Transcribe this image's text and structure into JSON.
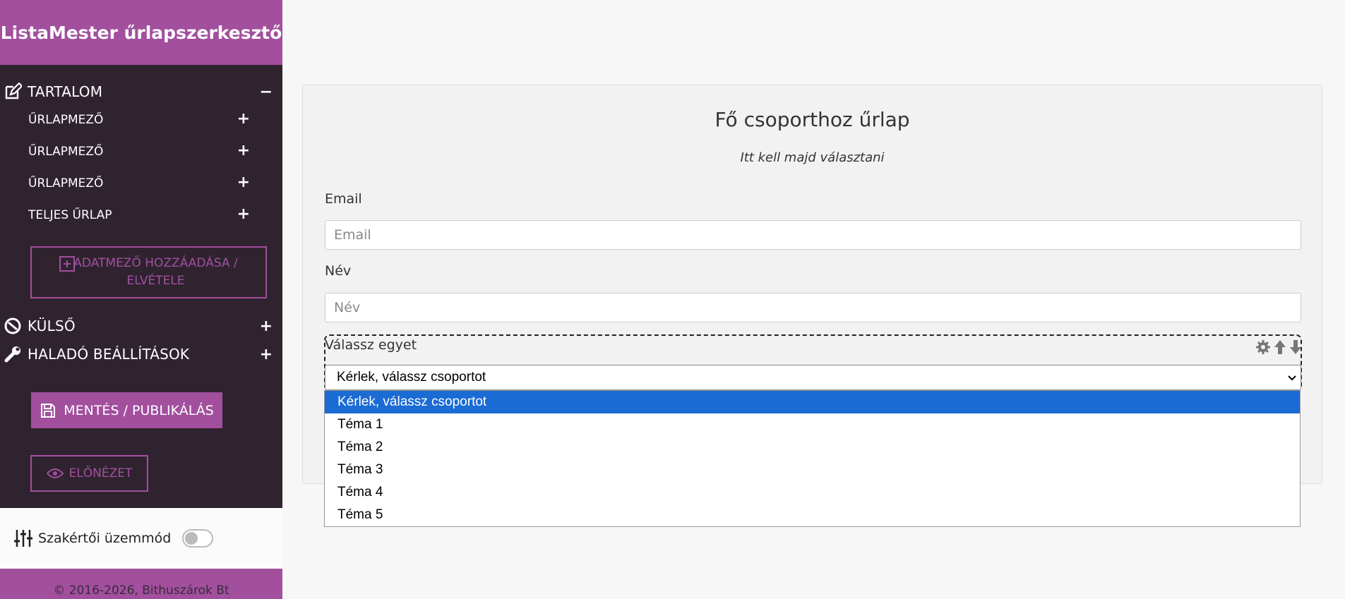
{
  "app": {
    "brand": "ListaMester űrlapszerkesztő"
  },
  "sidebar": {
    "content_section": {
      "label": "TARTALOM",
      "toggle": "−"
    },
    "items": [
      {
        "label": "ŰRLAPMEZŐ",
        "toggle": "+"
      },
      {
        "label": "ŰRLAPMEZŐ",
        "toggle": "+"
      },
      {
        "label": "ŰRLAPMEZŐ",
        "toggle": "+"
      },
      {
        "label": "TELJES ŰRLAP",
        "toggle": "+"
      }
    ],
    "add_field_button": "ADATMEZŐ HOZZÁADÁSA / ELVÉTELE",
    "external_section": {
      "label": "KÜLSŐ",
      "toggle": "+"
    },
    "advanced_section": {
      "label": "HALADÓ BEÁLLÍTÁSOK",
      "toggle": "+"
    },
    "save_button": "MENTÉS / PUBLIKÁLÁS",
    "preview_button": "ELŐNÉZET",
    "expert_mode": {
      "label": "Szakértői üzemmód",
      "enabled": false
    },
    "footer": "© 2016-2026, Bithuszárok Bt"
  },
  "form": {
    "title": "Fő csoporthoz űrlap",
    "subtitle": "Itt kell majd választani",
    "email": {
      "label": "Email",
      "placeholder": "Email"
    },
    "name": {
      "label": "Név",
      "placeholder": "Név"
    },
    "group_select": {
      "label": "Válassz egyet",
      "selected": "Kérlek, válassz csoportot",
      "options": [
        "Kérlek, válassz csoportot",
        "Téma 1",
        "Téma 2",
        "Téma 3",
        "Téma 4",
        "Téma 5"
      ]
    }
  },
  "colors": {
    "brand": "#a24f9e",
    "sidebar_bg": "#2f2330",
    "option_highlight": "#1a6bd4"
  }
}
